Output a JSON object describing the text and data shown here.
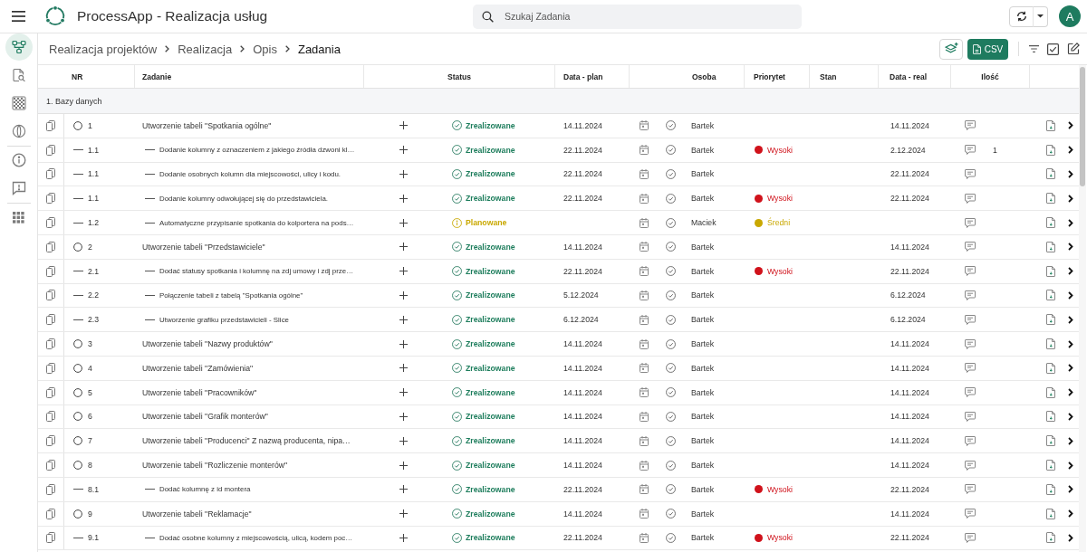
{
  "topbar": {
    "title": "ProcessApp - Realizacja usług",
    "search": {
      "placeholder": "Szukaj Zadania"
    },
    "avatar": "A"
  },
  "sidebar": {
    "sections": [
      {
        "items": [
          {
            "selected": true
          },
          {
            "selected": false
          },
          {
            "selected": false
          },
          {
            "selected": false
          }
        ]
      },
      {
        "items": [
          {
            "selected": false
          },
          {
            "selected": false
          }
        ]
      },
      {
        "items": [
          {
            "selected": false
          }
        ]
      }
    ]
  },
  "breadcrumb": [
    {
      "label": "Realizacja projektów",
      "current": false
    },
    {
      "label": "Realizacja",
      "current": false
    },
    {
      "label": "Opis",
      "current": false
    },
    {
      "label": "Zadania",
      "current": true
    }
  ],
  "toolbar": {
    "csv_button": "CSV"
  },
  "table": {
    "columns": [
      "NR",
      "Zadanie",
      "Status",
      "Data - plan",
      "Osoba",
      "Priorytet",
      "Stan",
      "Data - real",
      "Ilość"
    ],
    "groups": [
      {
        "label": "1. Bazy danych",
        "rows": [
          {
            "nr": "1",
            "title": "Utworzenie tabeli \"Spotkania ogólne\"",
            "status": {
              "label": "Zrealizowane",
              "kind": "done"
            },
            "plan": "14.11.2024",
            "person": "Bartek",
            "real": "14.11.2024",
            "children": [
              {
                "nr": "1.1",
                "title": "Dodanie kolumny z oznaczeniem z jakiego źródła dzwoni kl…",
                "status": {
                  "label": "Zrealizowane",
                  "kind": "done"
                },
                "plan": "22.11.2024",
                "person": "Bartek",
                "priority": {
                  "label": "Wysoki",
                  "color": "#d0121b"
                },
                "real": "2.12.2024",
                "qty": "1"
              },
              {
                "nr": "1.1",
                "title": "Dodanie osobnych kolumn dla miejscowości, ulicy i kodu.",
                "status": {
                  "label": "Zrealizowane",
                  "kind": "done"
                },
                "plan": "22.11.2024",
                "person": "Bartek",
                "real": "22.11.2024"
              },
              {
                "nr": "1.1",
                "title": "Dodanie kolumny odwołującej się do przedstawiciela.",
                "status": {
                  "label": "Zrealizowane",
                  "kind": "done"
                },
                "plan": "22.11.2024",
                "person": "Bartek",
                "priority": {
                  "label": "Wysoki",
                  "color": "#d0121b"
                },
                "real": "22.11.2024"
              },
              {
                "nr": "1.2",
                "title": "Automatyczne przypisanie spotkania do kolportera na pods…",
                "status": {
                  "label": "Planowane",
                  "kind": "planned"
                },
                "person": "Maciek",
                "priority": {
                  "label": "Średni",
                  "color": "#c9a800"
                }
              }
            ]
          },
          {
            "nr": "2",
            "title": "Utworzenie tabeli \"Przedstawiciele\"",
            "status": {
              "label": "Zrealizowane",
              "kind": "done"
            },
            "plan": "14.11.2024",
            "person": "Bartek",
            "real": "14.11.2024",
            "children": [
              {
                "nr": "2.1",
                "title": "Dodać statusy spotkania i kolumnę na zdj umowy i zdj prze…",
                "status": {
                  "label": "Zrealizowane",
                  "kind": "done"
                },
                "plan": "22.11.2024",
                "person": "Bartek",
                "priority": {
                  "label": "Wysoki",
                  "color": "#d0121b"
                },
                "real": "22.11.2024"
              },
              {
                "nr": "2.2",
                "title": "Połączenie tabeli z tabelą \"Spotkania ogólne\"",
                "status": {
                  "label": "Zrealizowane",
                  "kind": "done"
                },
                "plan": "5.12.2024",
                "person": "Bartek",
                "real": "6.12.2024"
              },
              {
                "nr": "2.3",
                "title": "Utworzenie grafiku przedstawicieli - Slice",
                "status": {
                  "label": "Zrealizowane",
                  "kind": "done"
                },
                "plan": "6.12.2024",
                "person": "Bartek",
                "real": "6.12.2024"
              }
            ]
          },
          {
            "nr": "3",
            "title": "Utworzenie tabeli \"Nazwy produktów\"",
            "status": {
              "label": "Zrealizowane",
              "kind": "done"
            },
            "plan": "14.11.2024",
            "person": "Bartek",
            "real": "14.11.2024"
          },
          {
            "nr": "4",
            "title": "Utworzenie tabeli \"Zamówienia\"",
            "status": {
              "label": "Zrealizowane",
              "kind": "done"
            },
            "plan": "14.11.2024",
            "person": "Bartek",
            "real": "14.11.2024"
          },
          {
            "nr": "5",
            "title": "Utworzenie tabeli \"Pracowników\"",
            "status": {
              "label": "Zrealizowane",
              "kind": "done"
            },
            "plan": "14.11.2024",
            "person": "Bartek",
            "real": "14.11.2024"
          },
          {
            "nr": "6",
            "title": "Utworzenie tabeli \"Grafik monterów\"",
            "status": {
              "label": "Zrealizowane",
              "kind": "done"
            },
            "plan": "14.11.2024",
            "person": "Bartek",
            "real": "14.11.2024"
          },
          {
            "nr": "7",
            "title": "Utworzenie tabeli \"Producenci\" Z nazwą producenta, nipa…",
            "status": {
              "label": "Zrealizowane",
              "kind": "done"
            },
            "plan": "14.11.2024",
            "person": "Bartek",
            "real": "14.11.2024"
          },
          {
            "nr": "8",
            "title": "Utworzenie tabeli \"Rozliczenie monterów\"",
            "status": {
              "label": "Zrealizowane",
              "kind": "done"
            },
            "plan": "14.11.2024",
            "person": "Bartek",
            "real": "14.11.2024",
            "children": [
              {
                "nr": "8.1",
                "title": "Dodać kolumnę z id montera",
                "status": {
                  "label": "Zrealizowane",
                  "kind": "done"
                },
                "plan": "22.11.2024",
                "person": "Bartek",
                "priority": {
                  "label": "Wysoki",
                  "color": "#d0121b"
                },
                "real": "22.11.2024"
              }
            ]
          },
          {
            "nr": "9",
            "title": "Utworzenie tabeli \"Reklamacje\"",
            "status": {
              "label": "Zrealizowane",
              "kind": "done"
            },
            "plan": "14.11.2024",
            "person": "Bartek",
            "real": "14.11.2024",
            "children": [
              {
                "nr": "9.1",
                "title": "Dodać osobne kolumny z miejscowością, ulicą, kodem poc…",
                "status": {
                  "label": "Zrealizowane",
                  "kind": "done"
                },
                "plan": "22.11.2024",
                "person": "Bartek",
                "priority": {
                  "label": "Wysoki",
                  "color": "#d0121b"
                },
                "real": "22.11.2024"
              }
            ]
          }
        ]
      }
    ]
  }
}
